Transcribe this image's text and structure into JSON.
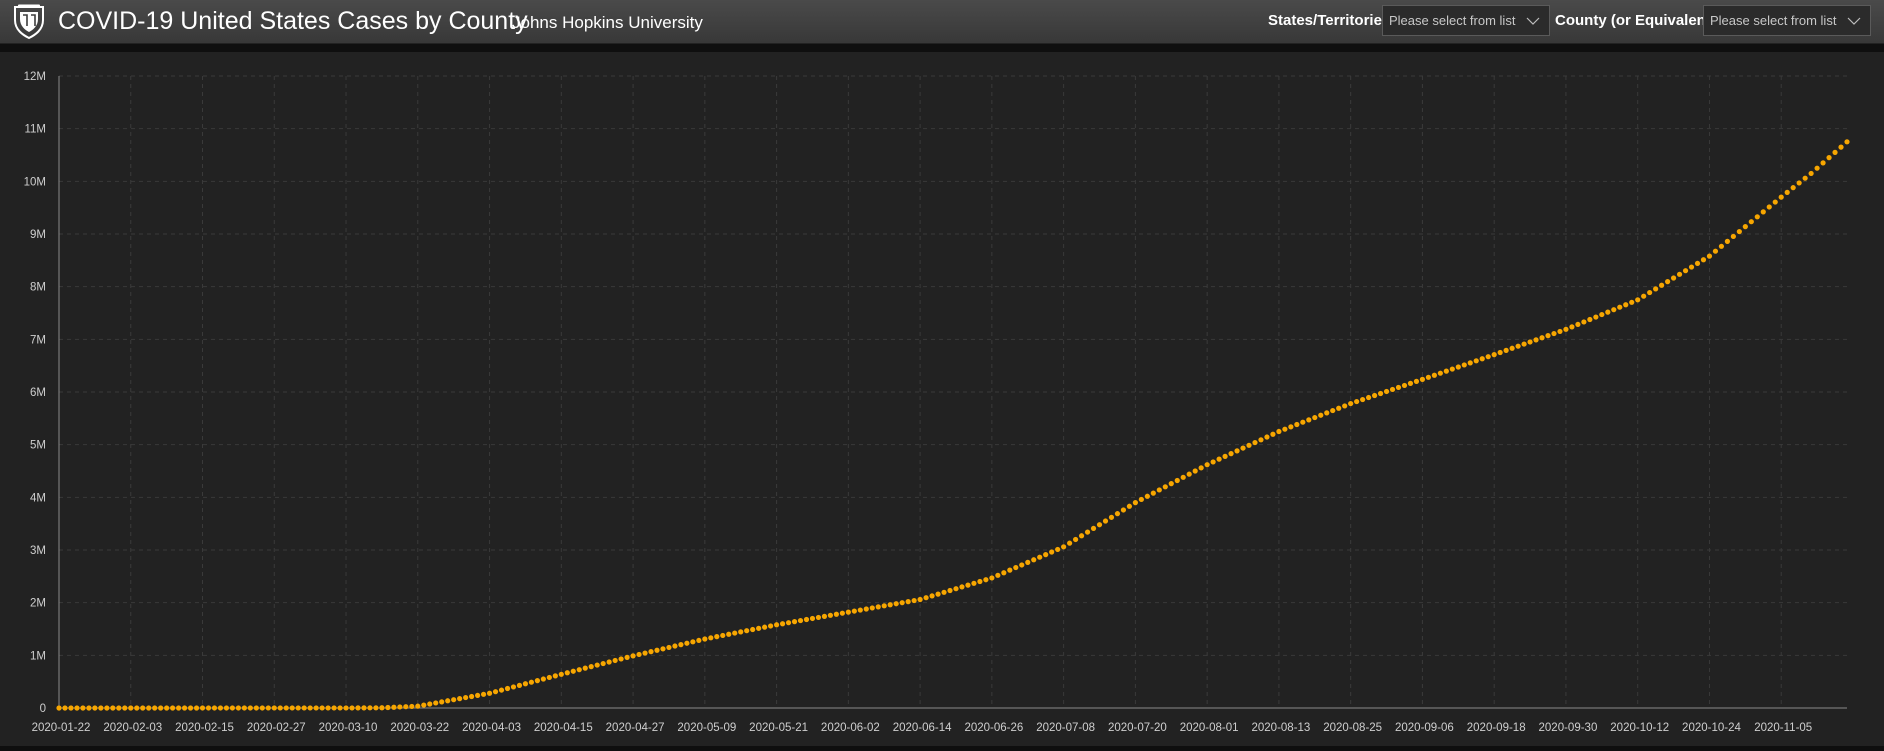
{
  "header": {
    "title": "COVID-19 United States Cases by County",
    "subtitle": "Johns Hopkins University",
    "logo_icon": "jhu-shield-icon",
    "background": "#3d3d3d"
  },
  "filters": {
    "states": {
      "label": "States/Territories",
      "placeholder": "Please select from list",
      "icon": "chevron-down-icon"
    },
    "county": {
      "label": "County (or Equivalent)",
      "placeholder": "Please select from list",
      "icon": "chevron-down-icon"
    }
  },
  "chart_data": {
    "type": "scatter",
    "title": "",
    "xlabel": "",
    "ylabel": "",
    "x_start": "2020-01-22",
    "x_end": "2020-11-16",
    "x_ticks": [
      "2020-01-22",
      "2020-02-03",
      "2020-02-15",
      "2020-02-27",
      "2020-03-10",
      "2020-03-22",
      "2020-04-03",
      "2020-04-15",
      "2020-04-27",
      "2020-05-09",
      "2020-05-21",
      "2020-06-02",
      "2020-06-14",
      "2020-06-26",
      "2020-07-08",
      "2020-07-20",
      "2020-08-01",
      "2020-08-13",
      "2020-08-25",
      "2020-09-06",
      "2020-09-18",
      "2020-09-30",
      "2020-10-12",
      "2020-10-24",
      "2020-11-05"
    ],
    "y_ticks": [
      "0",
      "1M",
      "2M",
      "3M",
      "4M",
      "5M",
      "6M",
      "7M",
      "8M",
      "9M",
      "10M",
      "11M",
      "12M"
    ],
    "ylim": [
      0,
      12000000
    ],
    "grid": true,
    "marker_color": "#f7a600",
    "series": [
      {
        "x": [
          "2020-01-22",
          "2020-03-10",
          "2020-03-16",
          "2020-03-22",
          "2020-04-03",
          "2020-04-15",
          "2020-04-27",
          "2020-05-09",
          "2020-05-21",
          "2020-06-02",
          "2020-06-14",
          "2020-06-26",
          "2020-07-08",
          "2020-07-20",
          "2020-08-01",
          "2020-08-13",
          "2020-08-25",
          "2020-09-06",
          "2020-09-18",
          "2020-09-30",
          "2020-10-12",
          "2020-10-24",
          "2020-11-05",
          "2020-11-10",
          "2020-11-16"
        ],
        "y": [
          0,
          1000,
          4500,
          35000,
          280000,
          640000,
          990000,
          1310000,
          1580000,
          1820000,
          2060000,
          2470000,
          3060000,
          3900000,
          4620000,
          5250000,
          5780000,
          6240000,
          6710000,
          7190000,
          7750000,
          8580000,
          9700000,
          10150000,
          10750000
        ]
      }
    ]
  }
}
